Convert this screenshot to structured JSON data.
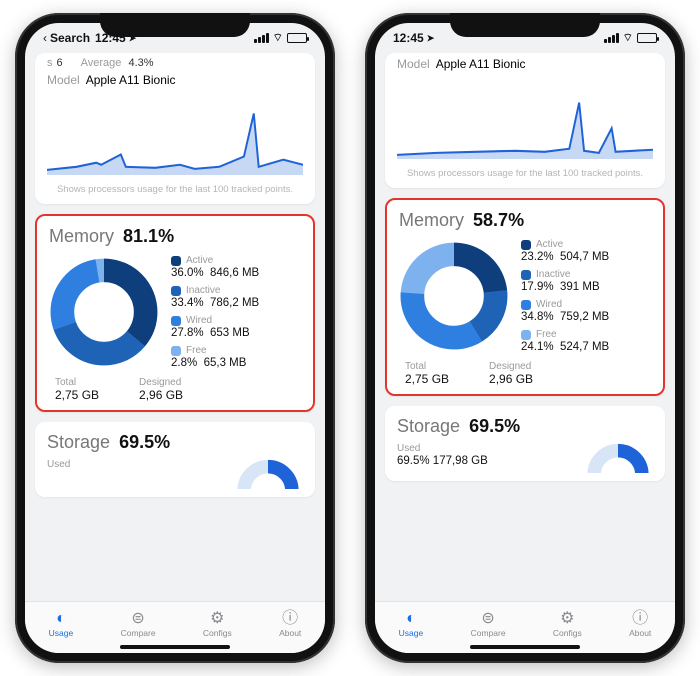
{
  "status": {
    "time": "12:45",
    "back_label": "Search"
  },
  "cpu": {
    "cores_label": "s",
    "cores_value": "6",
    "avg_label": "Average",
    "avg_value": "4.3%",
    "model_label": "Model",
    "model_value": "Apple A11 Bionic",
    "caption": "Shows processors usage for the last 100 tracked points."
  },
  "phones": [
    {
      "memory": {
        "title": "Memory",
        "pct": "81.1%",
        "items": [
          {
            "name": "Active",
            "color": "#0e3e7b",
            "pct": "36.0%",
            "size": "846,6 MB"
          },
          {
            "name": "Inactive",
            "color": "#1f63b7",
            "pct": "33.4%",
            "size": "786,2 MB"
          },
          {
            "name": "Wired",
            "color": "#2f7fe0",
            "pct": "27.8%",
            "size": "653 MB"
          },
          {
            "name": "Free",
            "color": "#7db2ef",
            "pct": "2.8%",
            "size": "65,3 MB"
          }
        ],
        "total_label": "Total",
        "total_value": "2,75 GB",
        "designed_label": "Designed",
        "designed_value": "2,96 GB"
      },
      "storage": {
        "title": "Storage",
        "pct": "69.5%",
        "used_label": "Used"
      }
    },
    {
      "memory": {
        "title": "Memory",
        "pct": "58.7%",
        "items": [
          {
            "name": "Active",
            "color": "#0e3e7b",
            "pct": "23.2%",
            "size": "504,7 MB"
          },
          {
            "name": "Inactive",
            "color": "#1f63b7",
            "pct": "17.9%",
            "size": "391 MB"
          },
          {
            "name": "Wired",
            "color": "#2f7fe0",
            "pct": "34.8%",
            "size": "759,2 MB"
          },
          {
            "name": "Free",
            "color": "#7db2ef",
            "pct": "24.1%",
            "size": "524,7 MB"
          }
        ],
        "total_label": "Total",
        "total_value": "2,75 GB",
        "designed_label": "Designed",
        "designed_value": "2,96 GB"
      },
      "storage": {
        "title": "Storage",
        "pct": "69.5%",
        "used_label": "Used",
        "used_value": "69.5%  177,98 GB"
      }
    }
  ],
  "tabs": [
    {
      "label": "Usage",
      "icon": "◐",
      "active": true
    },
    {
      "label": "Compare",
      "icon": "⊜",
      "active": false
    },
    {
      "label": "Configs",
      "icon": "⚙",
      "active": false
    },
    {
      "label": "About",
      "icon": "ⓘ",
      "active": false
    }
  ],
  "chart_data": [
    {
      "type": "pie",
      "title": "Memory 81.1%",
      "slices": [
        {
          "label": "Active",
          "value": 36.0,
          "size_mb": 846.6,
          "color": "#0e3e7b"
        },
        {
          "label": "Inactive",
          "value": 33.4,
          "size_mb": 786.2,
          "color": "#1f63b7"
        },
        {
          "label": "Wired",
          "value": 27.8,
          "size_mb": 653.0,
          "color": "#2f7fe0"
        },
        {
          "label": "Free",
          "value": 2.8,
          "size_mb": 65.3,
          "color": "#7db2ef"
        }
      ],
      "total_gb": 2.75,
      "designed_gb": 2.96,
      "inner_hole": true
    },
    {
      "type": "pie",
      "title": "Memory 58.7%",
      "slices": [
        {
          "label": "Active",
          "value": 23.2,
          "size_mb": 504.7,
          "color": "#0e3e7b"
        },
        {
          "label": "Inactive",
          "value": 17.9,
          "size_mb": 391.0,
          "color": "#1f63b7"
        },
        {
          "label": "Wired",
          "value": 34.8,
          "size_mb": 759.2,
          "color": "#2f7fe0"
        },
        {
          "label": "Free",
          "value": 24.1,
          "size_mb": 524.7,
          "color": "#7db2ef"
        }
      ],
      "total_gb": 2.75,
      "designed_gb": 2.96,
      "inner_hole": true
    }
  ]
}
